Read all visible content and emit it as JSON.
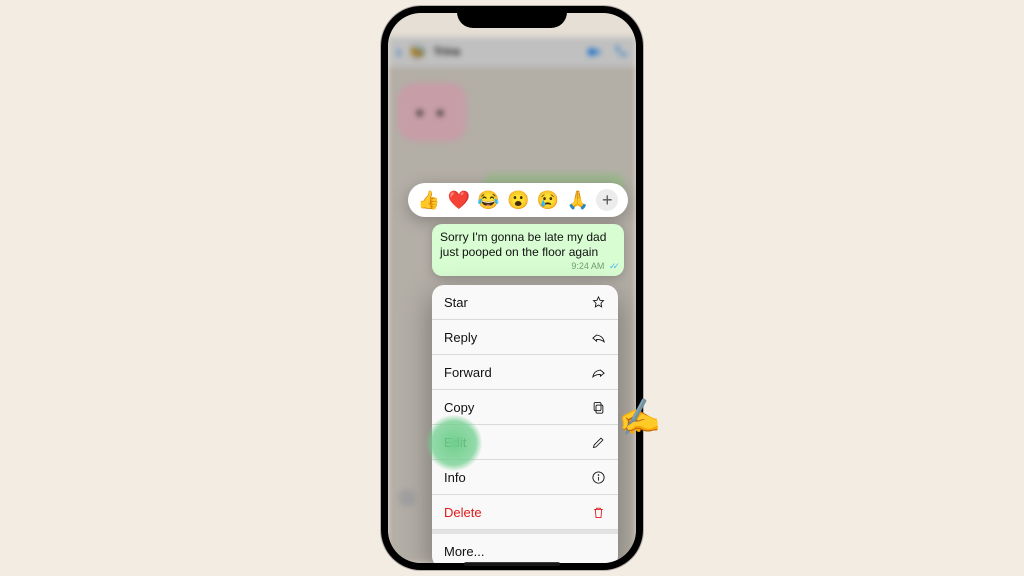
{
  "header": {
    "contact_name": "Trina",
    "avatar_emoji": "🐝"
  },
  "reactions": {
    "emojis": [
      "👍",
      "❤️",
      "😂",
      "😮",
      "😢",
      "🙏"
    ],
    "plus": "+"
  },
  "message": {
    "text": "Sorry I'm gonna be late my dad just pooped on the floor again",
    "time": "9:24 AM",
    "ticks": "✓✓"
  },
  "menu": {
    "star": {
      "label": "Star"
    },
    "reply": {
      "label": "Reply"
    },
    "forward": {
      "label": "Forward"
    },
    "copy": {
      "label": "Copy"
    },
    "edit": {
      "label": "Edit"
    },
    "info": {
      "label": "Info"
    },
    "delete": {
      "label": "Delete"
    },
    "more": {
      "label": "More..."
    }
  },
  "pointer_emoji": "✍️"
}
